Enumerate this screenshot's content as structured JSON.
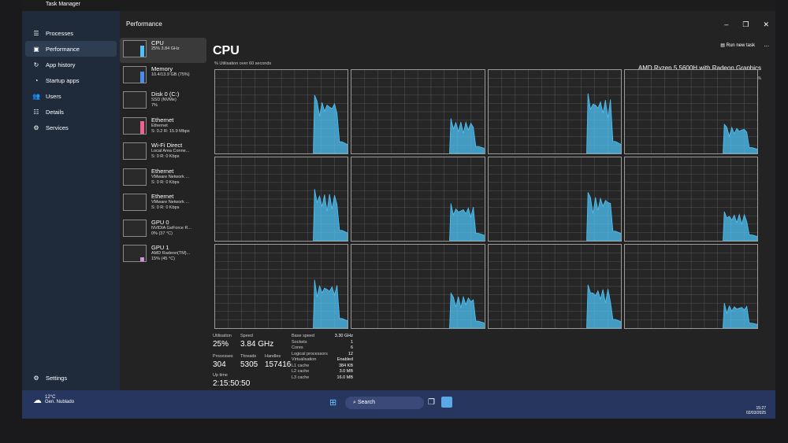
{
  "window": {
    "title": "Task Manager",
    "panel_title": "Performance",
    "run_task": "Run new task",
    "more": "..."
  },
  "nav": [
    {
      "icon": "☰",
      "label": "Processes"
    },
    {
      "icon": "▣",
      "label": "Performance"
    },
    {
      "icon": "↻",
      "label": "App history"
    },
    {
      "icon": "◔",
      "label": "Startup apps"
    },
    {
      "icon": "👥",
      "label": "Users"
    },
    {
      "icon": "☷",
      "label": "Details"
    },
    {
      "icon": "⚙",
      "label": "Services"
    }
  ],
  "settings": "Settings",
  "devices": [
    {
      "name": "CPU",
      "l1": "25% 3.84 GHz",
      "l2": "",
      "color": "#4fc3f7"
    },
    {
      "name": "Memory",
      "l1": "10.4/13.9 GB (75%)",
      "l2": "",
      "color": "#4a8cf0"
    },
    {
      "name": "Disk 0 (C:)",
      "l1": "SSD (NVMe)",
      "l2": "7%",
      "color": "#8bc34a"
    },
    {
      "name": "Ethernet",
      "l1": "Ethernet",
      "l2": "S: 0.2 R: 15.9 Mbps",
      "color": "#f06292"
    },
    {
      "name": "Wi-Fi Direct",
      "l1": "Local Area Conne...",
      "l2": "S: 0 R: 0 Kbps",
      "color": "#f06292"
    },
    {
      "name": "Ethernet",
      "l1": "VMware Network ...",
      "l2": "S: 0 R: 0 Kbps",
      "color": "#f06292"
    },
    {
      "name": "Ethernet",
      "l1": "VMware Network ...",
      "l2": "S: 0 R: 0 Kbps",
      "color": "#f06292"
    },
    {
      "name": "GPU 0",
      "l1": "NVIDIA GeForce R...",
      "l2": "0% (37 °C)",
      "color": "#ce93d8"
    },
    {
      "name": "GPU 1",
      "l1": "AMD Radeon(TM)...",
      "l2": "15% (45 °C)",
      "color": "#ce93d8"
    }
  ],
  "cpu": {
    "title": "CPU",
    "model": "AMD Ryzen 5 5600H with Radeon Graphics",
    "util_label": "% Utilisation over 60 seconds",
    "max_label": "100%",
    "core_peaks": [
      70,
      42,
      72,
      35,
      62,
      45,
      58,
      35,
      58,
      42,
      52,
      30
    ],
    "stats": {
      "utilisation_label": "Utilisation",
      "utilisation": "25%",
      "speed_label": "Speed",
      "speed": "3.84 GHz",
      "processes_label": "Processes",
      "processes": "304",
      "threads_label": "Threads",
      "threads": "5305",
      "handles_label": "Handles",
      "handles": "157416",
      "uptime_label": "Up time",
      "uptime": "2:15:50:50"
    },
    "specs": [
      [
        "Base speed",
        "3.30 GHz"
      ],
      [
        "Sockets",
        "1"
      ],
      [
        "Cores",
        "6"
      ],
      [
        "Logical processors",
        "12"
      ],
      [
        "Virtualisation",
        "Enabled"
      ],
      [
        "L1 cache",
        "384 KB"
      ],
      [
        "L2 cache",
        "3.0 MB"
      ],
      [
        "L3 cache",
        "16.0 MB"
      ]
    ]
  },
  "taskbar": {
    "temp": "12°C",
    "weather": "Gen. Nublado",
    "search": "Search",
    "time": "15:27",
    "date": "02/03/2025"
  },
  "colors": {
    "graph": "#4fc3f7"
  }
}
